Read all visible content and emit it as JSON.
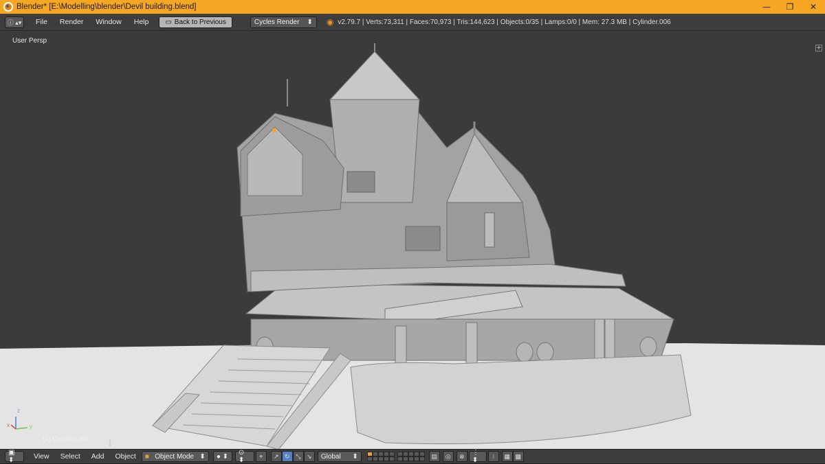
{
  "window": {
    "title": "Blender* [E:\\Modelling\\blender\\Devil building.blend]",
    "controls": {
      "minimize": "—",
      "maximize": "❐",
      "close": "✕"
    }
  },
  "topbar": {
    "menu": [
      "File",
      "Render",
      "Window",
      "Help"
    ],
    "back_button": "Back to Previous",
    "render_engine": "Cycles Render",
    "stats": "v2.79.7 | Verts:73,311 | Faces:70,973 | Tris:144,623 | Objects:0/35 | Lamps:0/0 | Mem: 27.3 MB | Cylinder.006"
  },
  "viewport": {
    "view_label": "User Persp",
    "object_label": "(1) Cylinder.006",
    "axis": {
      "x": "x",
      "y": "y",
      "z": "z"
    }
  },
  "bottombar": {
    "menu": [
      "View",
      "Select",
      "Add",
      "Object"
    ],
    "mode": "Object Mode",
    "transform_orientation": "Global"
  },
  "colors": {
    "titlebar": "#f5a623",
    "header": "#3d3d3d",
    "viewport_bg": "#3b3b3b",
    "ground": "#e6e6e6",
    "model": "#a6a6a6"
  }
}
